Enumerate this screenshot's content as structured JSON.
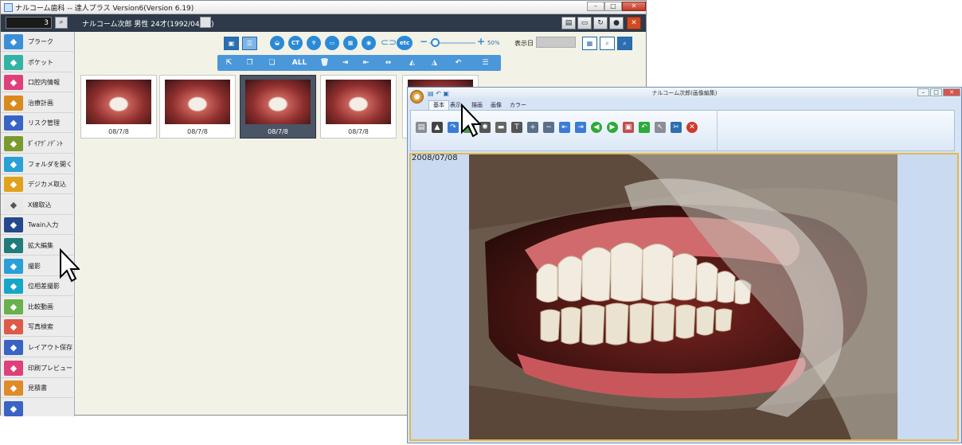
{
  "main_window": {
    "title": "ナルコーム歯科 -- 達人プラス Version6(Version 6.19)",
    "patient_id": "3",
    "patient_label": "ナルコーム次郎 男性 24才(1992/04/07)"
  },
  "sidebar": {
    "items": [
      {
        "label": "プラーク",
        "color": "#3b8fd8",
        "icon": "plaque-icon"
      },
      {
        "label": "ポケット",
        "color": "#33b3a6",
        "icon": "pocket-icon"
      },
      {
        "label": "口腔内情報",
        "color": "#e0407a",
        "icon": "mouth-icon"
      },
      {
        "label": "治療計画",
        "color": "#d98a1c",
        "icon": "plan-icon"
      },
      {
        "label": "リスク管理",
        "color": "#3a63c6",
        "icon": "risk-icon"
      },
      {
        "label": "ﾀﾞｲｱｸﾞﾉﾃﾞﾝﾄ",
        "color": "#7a9a30",
        "icon": "diagnodent-icon"
      },
      {
        "label": "フォルダを開く",
        "color": "#2aa0d8",
        "icon": "folder-icon"
      },
      {
        "label": "デジカメ取込",
        "color": "#e0a21c",
        "icon": "camera-import-icon"
      },
      {
        "label": "X線取込",
        "color": "#e8e8e8",
        "icon": "xray-icon"
      },
      {
        "label": "Twain入力",
        "color": "#24498c",
        "icon": "twain-icon"
      },
      {
        "label": "拡大編集",
        "color": "#1f7c7a",
        "icon": "zoom-edit-icon"
      },
      {
        "label": "撮影",
        "color": "#2aa0d8",
        "icon": "shoot-icon"
      },
      {
        "label": "位相差撮影",
        "color": "#16a6c8",
        "icon": "microscope-icon"
      },
      {
        "label": "比較動画",
        "color": "#6ab04c",
        "icon": "compare-video-icon"
      },
      {
        "label": "写真検索",
        "color": "#e05a4a",
        "icon": "photo-search-icon"
      },
      {
        "label": "レイアウト保存",
        "color": "#3a63c6",
        "icon": "layout-icon"
      },
      {
        "label": "印刷プレビュー",
        "color": "#e0407a",
        "icon": "print-icon"
      },
      {
        "label": "見積書",
        "color": "#e08a2a",
        "icon": "estimate-icon"
      },
      {
        "label": "",
        "color": "#3a63c6",
        "icon": "more-icon"
      }
    ]
  },
  "toolbar": {
    "ct_label": "CT",
    "etc_label": "etc",
    "all_label": "ALL",
    "zoom_percent": "50%",
    "display_date_label": "表示日"
  },
  "thumbnails": [
    {
      "date": "08/7/8",
      "selected": false
    },
    {
      "date": "08/7/8",
      "selected": false
    },
    {
      "date": "08/7/8",
      "selected": true
    },
    {
      "date": "08/7/8",
      "selected": false
    },
    {
      "date": "",
      "selected": false
    }
  ],
  "editor": {
    "title": "ナルコーム次郎(画像編集)",
    "tabs": [
      "基本",
      "表示",
      "描画",
      "画像",
      "カラー"
    ],
    "photo_date": "2008/07/08"
  },
  "colors": {
    "header_bar": "#2e3a4a",
    "accent_blue": "#2b8ad6",
    "frame_gold": "#e4b84a"
  }
}
